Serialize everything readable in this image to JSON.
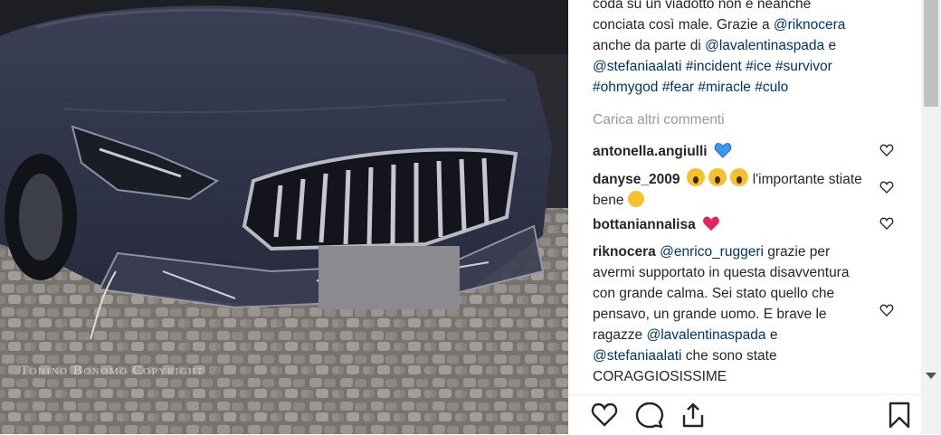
{
  "photo": {
    "watermark": "Tonino Bonomo Copyright",
    "colors": {
      "car_body": "#2f3348",
      "pavement": "#8a8682"
    }
  },
  "caption": {
    "line1_prefix": "coda su un viadotto non è neanche",
    "line2_prefix": "conciata così male. Grazie a ",
    "mention_riknocera": "@riknocera",
    "line3_prefix": "anche da parte di ",
    "mention_lavalentinaspada": "@lavalentinaspada",
    "line3_suffix": " e",
    "mention_stefaniaalati": "@stefaniaalati",
    "tags_line4": " #incident #ice #survivor",
    "tags_line5": "#ohmygod #fear #miracle #culo"
  },
  "load_more": "Carica altri commenti",
  "comments": [
    {
      "user": "antonella.angiulli",
      "text": "",
      "emoji": "blue-heart"
    },
    {
      "user": "danyse_2009",
      "text": " l'importante stiate bene ",
      "emoji": "scream-face"
    },
    {
      "user": "bottaniannalisa",
      "text": "",
      "emoji": "red-heart"
    },
    {
      "user": "riknocera",
      "mention1": "@enrico_ruggeri",
      "text1": " grazie per avermi supportato in questa disavventura con grande calma. Sei stato quello che pensavo, un grande uomo. E brave le ragazze ",
      "mention2": "@lavalentinaspada",
      "text2": " e ",
      "mention3": "@stefaniaalati",
      "text3": " che sono state CORAGGIOSISSIME"
    }
  ],
  "actions": [
    "like-icon",
    "comment-icon",
    "share-icon",
    "save-icon"
  ],
  "colors": {
    "text": "#262626",
    "mention": "#003569",
    "muted": "#999999",
    "blue_heart": "#3897f0",
    "red_heart": "#e0245e"
  }
}
